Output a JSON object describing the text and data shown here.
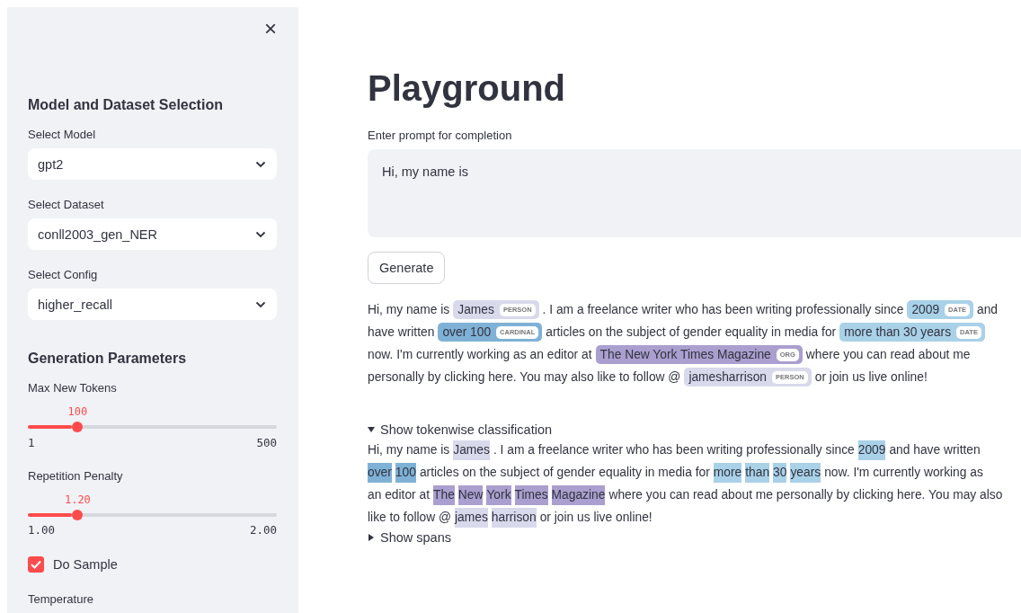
{
  "sidebar": {
    "close": "×",
    "sections": [
      {
        "title": "Model and Dataset Selection",
        "controls": [
          {
            "kind": "select",
            "label": "Select Model",
            "value": "gpt2"
          },
          {
            "kind": "select",
            "label": "Select Dataset",
            "value": "conll2003_gen_NER"
          },
          {
            "kind": "select",
            "label": "Select Config",
            "value": "higher_recall"
          }
        ]
      },
      {
        "title": "Generation Parameters",
        "controls": [
          {
            "kind": "slider",
            "label": "Max New Tokens",
            "value": "100",
            "min": "1",
            "max": "500",
            "level": 0.2
          },
          {
            "kind": "slider",
            "label": "Repetition Penalty",
            "value": "1.20",
            "min": "1.00",
            "max": "2.00",
            "level": 0.2
          },
          {
            "kind": "checkbox",
            "label": "Do Sample",
            "checked": true
          },
          {
            "kind": "label",
            "label": "Temperature"
          }
        ]
      }
    ]
  },
  "main": {
    "title": "Playground",
    "prompt": {
      "label": "Enter prompt for completion",
      "value": "Hi, my name is"
    },
    "button": "Generate",
    "entity_lines": [
      [
        {
          "kind": "text",
          "text": "Hi, my name is"
        },
        {
          "kind": "entity",
          "text": "James",
          "label": "PERSON",
          "color": "#d9d9ec"
        },
        {
          "kind": "text",
          "text": ". I am a freelance writer who has been writing professionally since"
        },
        {
          "kind": "entity",
          "text": "2009",
          "label": "DATE",
          "color": "#a9d1e8"
        },
        {
          "kind": "text",
          "text": "and"
        }
      ],
      [
        {
          "kind": "text",
          "text": "have written"
        },
        {
          "kind": "entity",
          "text": "over 100",
          "label": "CARDINAL",
          "color": "#7fb1d6"
        },
        {
          "kind": "text",
          "text": "articles on the subject of gender equality in media for"
        },
        {
          "kind": "entity",
          "text": "more than 30 years",
          "label": "DATE",
          "color": "#a9d1e8"
        }
      ],
      [
        {
          "kind": "text",
          "text": "now. I'm currently working as an editor at"
        },
        {
          "kind": "entity",
          "text": "The New York Times Magazine",
          "label": "ORG",
          "color": "#ab9fd0"
        },
        {
          "kind": "text",
          "text": "where you can read about me"
        }
      ],
      [
        {
          "kind": "text",
          "text": "personally by clicking here. You may also like to follow @"
        },
        {
          "kind": "entity",
          "text": "jamesharrison",
          "label": "PERSON",
          "color": "#d9d9ec"
        },
        {
          "kind": "text",
          "text": "or join us live online!"
        }
      ]
    ],
    "tokenwise": {
      "label": "Show tokenwise classification",
      "expanded": true,
      "lines": [
        [
          {
            "text": "Hi, my name is"
          },
          {
            "text": "James",
            "color": "#d9d9ec"
          },
          {
            "text": ". I am a freelance writer who has been writing professionally since"
          },
          {
            "text": "2009",
            "color": "#a9d1e8"
          },
          {
            "text": "and have written"
          }
        ],
        [
          {
            "text": "over",
            "color": "#7fb1d6"
          },
          {
            "text": "100",
            "color": "#7fb1d6"
          },
          {
            "text": "articles on the subject of gender equality in media for"
          },
          {
            "text": "more",
            "color": "#a9d1e8"
          },
          {
            "text": "than",
            "color": "#a9d1e8"
          },
          {
            "text": "30",
            "color": "#a9d1e8"
          },
          {
            "text": "years",
            "color": "#a9d1e8"
          },
          {
            "text": "now. I'm currently working as"
          }
        ],
        [
          {
            "text": "an editor at"
          },
          {
            "text": "The",
            "color": "#ab9fd0"
          },
          {
            "text": "New",
            "color": "#ab9fd0"
          },
          {
            "text": "York",
            "color": "#ab9fd0"
          },
          {
            "text": "Times",
            "color": "#ab9fd0"
          },
          {
            "text": "Magazine",
            "color": "#ab9fd0"
          },
          {
            "text": "where you can read about me personally by clicking here. You may also"
          }
        ],
        [
          {
            "text": "like to follow @"
          },
          {
            "text": "james",
            "color": "#d9d9ec"
          },
          {
            "text": "harrison",
            "color": "#d9d9ec"
          },
          {
            "text": "or join us live online!"
          }
        ]
      ]
    },
    "spans": {
      "label": "Show spans",
      "expanded": false
    }
  }
}
